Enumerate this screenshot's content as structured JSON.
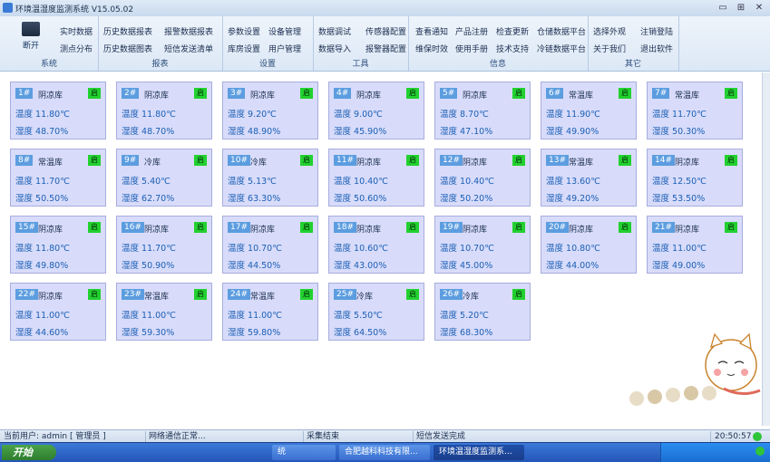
{
  "window": {
    "title": "环境温湿度监测系统 V15.05.02",
    "controls": [
      "▭",
      "⊞",
      "✕"
    ]
  },
  "ribbon": {
    "groups": [
      {
        "label": "系统",
        "items": [
          "断开"
        ]
      },
      {
        "label": "",
        "items": [
          "实时数据",
          "测点分布"
        ]
      },
      {
        "label": "报表",
        "items": [
          "历史数据报表",
          "历史数据图表",
          "报警数据报表",
          "短信发送清单"
        ]
      },
      {
        "label": "设置",
        "items": [
          "参数设置",
          "设备管理",
          "库房设置",
          "用户管理"
        ]
      },
      {
        "label": "工具",
        "items": [
          "数据调试",
          "传感器配置",
          "数据导入",
          "报警器配置"
        ]
      },
      {
        "label": "信息",
        "items": [
          "查看通知",
          "产品注册",
          "检查更新",
          "仓储数据平台",
          "维保时效",
          "使用手册",
          "技术支持",
          "冷链数据平台"
        ]
      },
      {
        "label": "其它",
        "items": [
          "选择外观",
          "注销登陆",
          "关于我们",
          "退出软件"
        ]
      }
    ]
  },
  "cards": [
    {
      "num": "1#",
      "type": "阴凉库",
      "status": "启",
      "temp": "温度 11.80℃",
      "hum": "湿度 48.70%"
    },
    {
      "num": "2#",
      "type": "阴凉库",
      "status": "启",
      "temp": "温度 11.80℃",
      "hum": "湿度 48.70%"
    },
    {
      "num": "3#",
      "type": "阴凉库",
      "status": "启",
      "temp": "温度 9.20℃",
      "hum": "湿度 48.90%"
    },
    {
      "num": "4#",
      "type": "阴凉库",
      "status": "启",
      "temp": "温度 9.00℃",
      "hum": "湿度 45.90%"
    },
    {
      "num": "5#",
      "type": "阴凉库",
      "status": "启",
      "temp": "温度 8.70℃",
      "hum": "湿度 47.10%"
    },
    {
      "num": "6#",
      "type": "常温库",
      "status": "启",
      "temp": "温度 11.90℃",
      "hum": "湿度 49.90%"
    },
    {
      "num": "7#",
      "type": "常温库",
      "status": "启",
      "temp": "温度 11.70℃",
      "hum": "湿度 50.30%"
    },
    {
      "num": "8#",
      "type": "常温库",
      "status": "启",
      "temp": "温度 11.70℃",
      "hum": "湿度 50.50%"
    },
    {
      "num": "9#",
      "type": "冷库",
      "status": "启",
      "temp": "温度 5.40℃",
      "hum": "湿度 62.70%"
    },
    {
      "num": "10#",
      "type": "冷库",
      "status": "启",
      "temp": "温度 5.13℃",
      "hum": "湿度 63.30%"
    },
    {
      "num": "11#",
      "type": "阴凉库",
      "status": "启",
      "temp": "温度 10.40℃",
      "hum": "湿度 50.60%"
    },
    {
      "num": "12#",
      "type": "阴凉库",
      "status": "启",
      "temp": "温度 10.40℃",
      "hum": "湿度 50.20%"
    },
    {
      "num": "13#",
      "type": "常温库",
      "status": "启",
      "temp": "温度 13.60℃",
      "hum": "湿度 49.20%"
    },
    {
      "num": "14#",
      "type": "阴凉库",
      "status": "启",
      "temp": "温度 12.50℃",
      "hum": "湿度 53.50%"
    },
    {
      "num": "15#",
      "type": "阴凉库",
      "status": "启",
      "temp": "温度 11.80℃",
      "hum": "湿度 49.80%"
    },
    {
      "num": "16#",
      "type": "阴凉库",
      "status": "启",
      "temp": "温度 11.70℃",
      "hum": "湿度 50.90%"
    },
    {
      "num": "17#",
      "type": "阴凉库",
      "status": "启",
      "temp": "温度 10.70℃",
      "hum": "湿度 44.50%"
    },
    {
      "num": "18#",
      "type": "阴凉库",
      "status": "启",
      "temp": "温度 10.60℃",
      "hum": "湿度 43.00%"
    },
    {
      "num": "19#",
      "type": "阴凉库",
      "status": "启",
      "temp": "温度 10.70℃",
      "hum": "湿度 45.00%"
    },
    {
      "num": "20#",
      "type": "阴凉库",
      "status": "启",
      "temp": "温度 10.80℃",
      "hum": "湿度 44.00%"
    },
    {
      "num": "21#",
      "type": "阴凉库",
      "status": "启",
      "temp": "温度 11.00℃",
      "hum": "湿度 49.00%"
    },
    {
      "num": "22#",
      "type": "阴凉库",
      "status": "启",
      "temp": "温度 11.00℃",
      "hum": "湿度 44.60%"
    },
    {
      "num": "23#",
      "type": "常温库",
      "status": "启",
      "temp": "温度 11.00℃",
      "hum": "湿度 59.30%"
    },
    {
      "num": "24#",
      "type": "常温库",
      "status": "启",
      "temp": "温度 11.00℃",
      "hum": "湿度 59.80%"
    },
    {
      "num": "25#",
      "type": "冷库",
      "status": "启",
      "temp": "温度 5.50℃",
      "hum": "湿度 64.50%"
    },
    {
      "num": "26#",
      "type": "冷库",
      "status": "启",
      "temp": "温度 5.20℃",
      "hum": "湿度 68.30%"
    }
  ],
  "statusbar": {
    "user": "当前用户: admin [ 管理员 ]",
    "network": "网络通信正常...",
    "collect": "采集结束",
    "sms": "短信发送完成",
    "time": "20:50:57"
  },
  "taskbar": {
    "start": "开始",
    "items": [
      "统",
      "合肥越科科技有限...",
      "环境温湿度监测系..."
    ]
  },
  "colors": {
    "card_bg": "#d8dcfa",
    "num_badge": "#5c9de0",
    "status_on": "#22d12f",
    "value_text": "#1c5fb5"
  },
  "icons": [
    "connect-icon",
    "app-logo-icon",
    "network-status-icon"
  ]
}
